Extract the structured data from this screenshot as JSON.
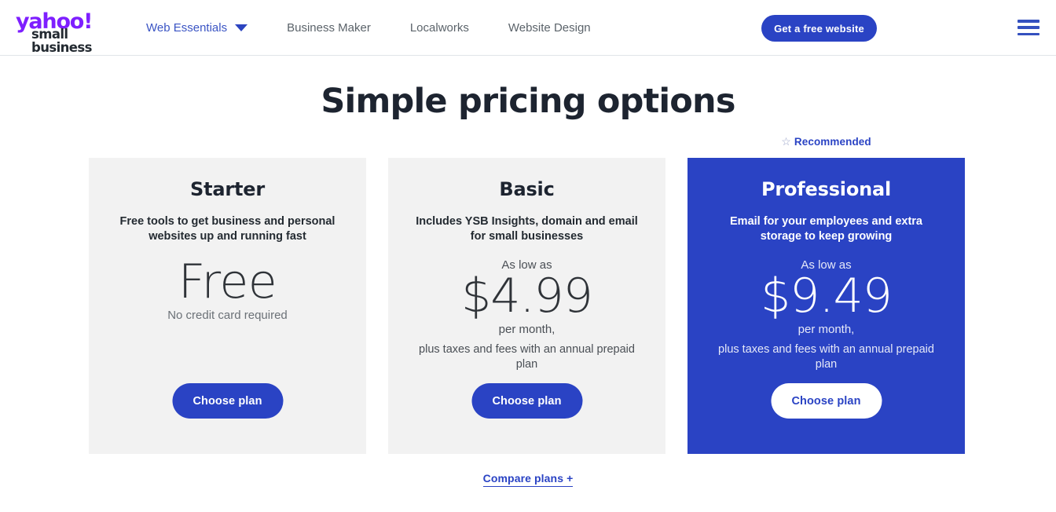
{
  "header": {
    "logo": {
      "brand": "yahoo!",
      "sub": "small business",
      "brand_color": "#7e1fff"
    },
    "nav_items": [
      {
        "label": "Web Essentials",
        "active": true,
        "has_caret": true
      },
      {
        "label": "Business Maker",
        "active": false,
        "has_caret": false
      },
      {
        "label": "Localworks",
        "active": false,
        "has_caret": false
      },
      {
        "label": "Website Design",
        "active": false,
        "has_caret": false
      }
    ],
    "cta_label": "Get a free website",
    "menu_icon": "hamburger-icon"
  },
  "page": {
    "title": "Simple pricing options",
    "accent_color": "#2a43c4",
    "card_bg": "#f2f2f2"
  },
  "recommended": {
    "label": "Recommended",
    "star": "☆"
  },
  "plans": [
    {
      "name": "Starter",
      "description": "Free tools to get business and personal websites up and running fast",
      "as_low_as": "",
      "price": "Free",
      "per_month": "",
      "fineprint": "",
      "subnote": "No credit card required",
      "button_label": "Choose plan",
      "featured": false
    },
    {
      "name": "Basic",
      "description": "Includes YSB Insights, domain and email for small businesses",
      "as_low_as": "As low as",
      "price": "$4.99",
      "per_month": "per month,",
      "fineprint": "plus taxes and fees with an annual prepaid plan",
      "subnote": "",
      "button_label": "Choose plan",
      "featured": false
    },
    {
      "name": "Professional",
      "description": "Email for your employees and extra storage to keep growing",
      "as_low_as": "As low as",
      "price": "$9.49",
      "per_month": "per month,",
      "fineprint": "plus taxes and fees with an annual prepaid plan",
      "subnote": "",
      "button_label": "Choose plan",
      "featured": true
    }
  ],
  "compare": {
    "label": "Compare plans +"
  }
}
